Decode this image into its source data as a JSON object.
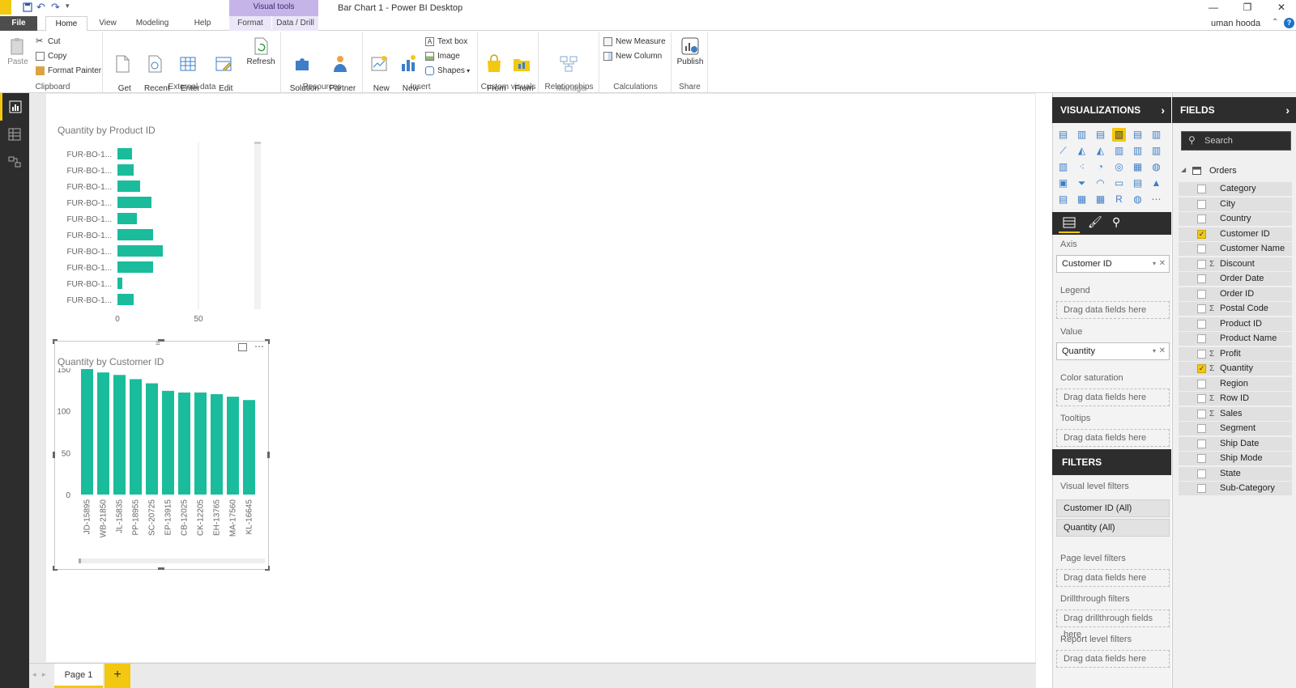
{
  "window": {
    "title": "Bar Chart 1 - Power BI Desktop",
    "context_tab": "Visual tools",
    "user": "uman hooda"
  },
  "tabs": [
    "File",
    "Home",
    "View",
    "Modeling",
    "Help",
    "Format",
    "Data / Drill"
  ],
  "ribbon": {
    "clipboard": {
      "label": "Clipboard",
      "paste": "Paste",
      "cut": "Cut",
      "copy": "Copy",
      "format_painter": "Format Painter"
    },
    "external": {
      "label": "External data",
      "get_data": "Get\nData",
      "recent_sources": "Recent\nSources",
      "enter_data": "Enter\nData",
      "edit_queries": "Edit\nQueries",
      "refresh": "Refresh"
    },
    "resources": {
      "label": "Resources",
      "solution_templates": "Solution\nTemplates",
      "partner_showcase": "Partner\nShowcase"
    },
    "insert": {
      "label": "Insert",
      "new_page": "New\nPage",
      "new_visual": "New\nVisual",
      "text_box": "Text box",
      "image": "Image",
      "shapes": "Shapes"
    },
    "custom_visuals": {
      "label": "Custom visuals",
      "from_store": "From\nStore",
      "from_file": "From\nFile"
    },
    "relationships": {
      "label": "Relationships",
      "manage": "Manage\nRelationships"
    },
    "calculations": {
      "label": "Calculations",
      "new_measure": "New Measure",
      "new_column": "New Column"
    },
    "share": {
      "label": "Share",
      "publish": "Publish"
    }
  },
  "visualizations": {
    "title": "VISUALIZATIONS",
    "wells": {
      "axis_label": "Axis",
      "axis_value": "Customer ID",
      "legend_label": "Legend",
      "value_label": "Value",
      "value_value": "Quantity",
      "color_label": "Color saturation",
      "tooltips_label": "Tooltips",
      "drop_placeholder": "Drag data fields here"
    }
  },
  "filters": {
    "title": "FILTERS",
    "visual_level": "Visual level filters",
    "pills": [
      "Customer ID (All)",
      "Quantity (All)"
    ],
    "page_level": "Page level filters",
    "drillthrough": "Drillthrough filters",
    "drillthrough_placeholder": "Drag drillthrough fields here",
    "report_level": "Report level filters",
    "drop_placeholder": "Drag data fields here"
  },
  "fields": {
    "title": "FIELDS",
    "search_placeholder": "Search",
    "table": "Orders",
    "items": [
      {
        "name": "Category",
        "checked": false,
        "sigma": false
      },
      {
        "name": "City",
        "checked": false,
        "sigma": false
      },
      {
        "name": "Country",
        "checked": false,
        "sigma": false
      },
      {
        "name": "Customer ID",
        "checked": true,
        "sigma": false
      },
      {
        "name": "Customer Name",
        "checked": false,
        "sigma": false
      },
      {
        "name": "Discount",
        "checked": false,
        "sigma": true
      },
      {
        "name": "Order Date",
        "checked": false,
        "sigma": false
      },
      {
        "name": "Order ID",
        "checked": false,
        "sigma": false
      },
      {
        "name": "Postal Code",
        "checked": false,
        "sigma": true
      },
      {
        "name": "Product ID",
        "checked": false,
        "sigma": false
      },
      {
        "name": "Product Name",
        "checked": false,
        "sigma": false
      },
      {
        "name": "Profit",
        "checked": false,
        "sigma": true
      },
      {
        "name": "Quantity",
        "checked": true,
        "sigma": true
      },
      {
        "name": "Region",
        "checked": false,
        "sigma": false
      },
      {
        "name": "Row ID",
        "checked": false,
        "sigma": true
      },
      {
        "name": "Sales",
        "checked": false,
        "sigma": true
      },
      {
        "name": "Segment",
        "checked": false,
        "sigma": false
      },
      {
        "name": "Ship Date",
        "checked": false,
        "sigma": false
      },
      {
        "name": "Ship Mode",
        "checked": false,
        "sigma": false
      },
      {
        "name": "State",
        "checked": false,
        "sigma": false
      },
      {
        "name": "Sub-Category",
        "checked": false,
        "sigma": false
      }
    ]
  },
  "pages": {
    "current": "Page 1",
    "add_symbol": "+"
  },
  "colors": {
    "bar": "#1abc9c",
    "accent": "#f2c811",
    "dark": "#2d2d2d"
  },
  "chart_data": [
    {
      "type": "bar",
      "orientation": "horizontal",
      "title": "Quantity by Product ID",
      "categories": [
        "FUR-BO-1...",
        "FUR-BO-1...",
        "FUR-BO-1...",
        "FUR-BO-1...",
        "FUR-BO-1...",
        "FUR-BO-1...",
        "FUR-BO-1...",
        "FUR-BO-1...",
        "FUR-BO-1...",
        "FUR-BO-1..."
      ],
      "values": [
        9,
        10,
        14,
        21,
        12,
        22,
        28,
        22,
        3,
        10
      ],
      "xlim": [
        0,
        50
      ],
      "xticks": [
        0,
        50
      ],
      "grid": true
    },
    {
      "type": "bar",
      "orientation": "vertical",
      "title": "Quantity by Customer ID",
      "categories": [
        "JD-15895",
        "WB-21850",
        "JL-15835",
        "PP-18955",
        "SC-20725",
        "EP-13915",
        "CB-12025",
        "CK-12205",
        "EH-13765",
        "MA-17560",
        "KL-16645"
      ],
      "values": [
        150,
        146,
        143,
        138,
        133,
        124,
        122,
        122,
        120,
        117,
        113
      ],
      "ylim": [
        0,
        150
      ],
      "yticks": [
        0,
        50,
        100,
        150
      ],
      "grid": false
    }
  ]
}
